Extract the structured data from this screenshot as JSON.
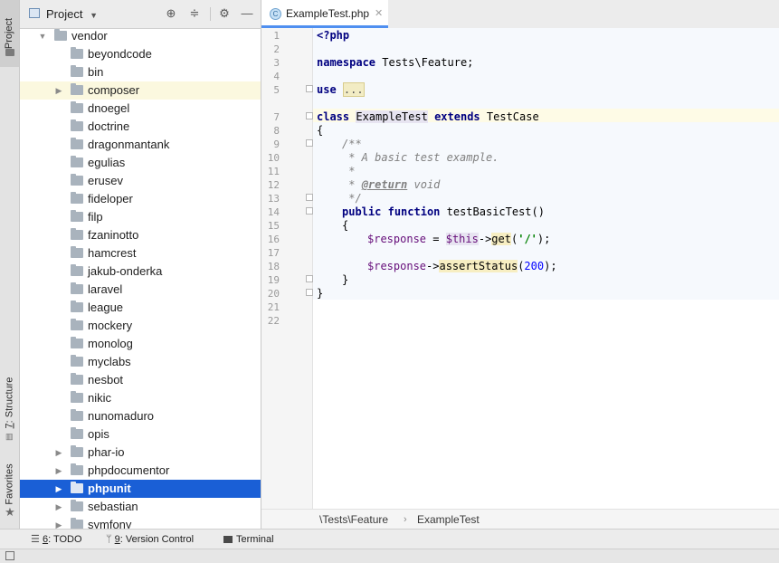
{
  "left_strip": {
    "project_label": "1: Project",
    "structure_label": "Z: Structure",
    "favorites_label": "2: Favorites"
  },
  "project_panel": {
    "title": "Project",
    "tree": [
      {
        "label": "vendor",
        "expanded": true,
        "level": 0
      },
      {
        "label": "beyondcode",
        "level": 1
      },
      {
        "label": "bin",
        "level": 1
      },
      {
        "label": "composer",
        "level": 1,
        "collapsed": true,
        "highlighted": true
      },
      {
        "label": "dnoegel",
        "level": 1
      },
      {
        "label": "doctrine",
        "level": 1
      },
      {
        "label": "dragonmantank",
        "level": 1
      },
      {
        "label": "egulias",
        "level": 1
      },
      {
        "label": "erusev",
        "level": 1
      },
      {
        "label": "fideloper",
        "level": 1
      },
      {
        "label": "filp",
        "level": 1
      },
      {
        "label": "fzaninotto",
        "level": 1
      },
      {
        "label": "hamcrest",
        "level": 1
      },
      {
        "label": "jakub-onderka",
        "level": 1
      },
      {
        "label": "laravel",
        "level": 1
      },
      {
        "label": "league",
        "level": 1
      },
      {
        "label": "mockery",
        "level": 1
      },
      {
        "label": "monolog",
        "level": 1
      },
      {
        "label": "myclabs",
        "level": 1
      },
      {
        "label": "nesbot",
        "level": 1
      },
      {
        "label": "nikic",
        "level": 1
      },
      {
        "label": "nunomaduro",
        "level": 1
      },
      {
        "label": "opis",
        "level": 1
      },
      {
        "label": "phar-io",
        "level": 1,
        "collapsed": true
      },
      {
        "label": "phpdocumentor",
        "level": 1,
        "collapsed": true
      },
      {
        "label": "phpunit",
        "level": 1,
        "collapsed": true,
        "selected": true
      },
      {
        "label": "sebastian",
        "level": 1,
        "collapsed": true
      },
      {
        "label": "symfony",
        "level": 1,
        "collapsed": true
      }
    ]
  },
  "editor": {
    "tab_label": "ExampleTest.php",
    "tab_icon_letter": "C",
    "line_numbers": [
      "1",
      "2",
      "3",
      "4",
      "5",
      "7",
      "8",
      "9",
      "10",
      "11",
      "12",
      "13",
      "14",
      "15",
      "16",
      "17",
      "18",
      "19",
      "20",
      "21",
      "22"
    ],
    "breadcrumb": {
      "namespace": "\\Tests\\Feature",
      "class": "ExampleTest"
    }
  },
  "code": {
    "l1": "<?php",
    "l3_kw": "namespace",
    "l3_rest": " Tests\\Feature;",
    "l5_kw": "use",
    "l5_fold": "...",
    "l8_kw1": "class",
    "l8_name": "ExampleTest",
    "l8_kw2": "extends",
    "l8_parent": "TestCase",
    "l9": "{",
    "l10": "/**",
    "l11": " * A basic test example.",
    "l12": " *",
    "l13_star": " * ",
    "l13_tag": "@return",
    "l13_type": " void",
    "l14": " */",
    "l15_kw1": "public",
    "l15_kw2": "function",
    "l15_name": " testBasicTest()",
    "l16": "{",
    "l17_var": "$response",
    "l17_eq": " = ",
    "l17_this": "$this",
    "l17_arrow": "->",
    "l17_get": "get",
    "l17_open": "(",
    "l17_str": "'/'",
    "l17_close": ");",
    "l19_var": "$response",
    "l19_arrow": "->",
    "l19_method": "assertStatus",
    "l19_open": "(",
    "l19_num": "200",
    "l19_close": ");",
    "l20": "}",
    "l21": "}"
  },
  "bottom_tools": {
    "todo_num": "6",
    "todo_label": ": TODO",
    "vcs_num": "9",
    "vcs_label": ": Version Control",
    "terminal_label": "Terminal"
  },
  "colors": {
    "selection": "#1a5fd6",
    "highlight_row": "#fbf8df",
    "keyword": "#000080",
    "tab_underline": "#4f8ff0"
  }
}
